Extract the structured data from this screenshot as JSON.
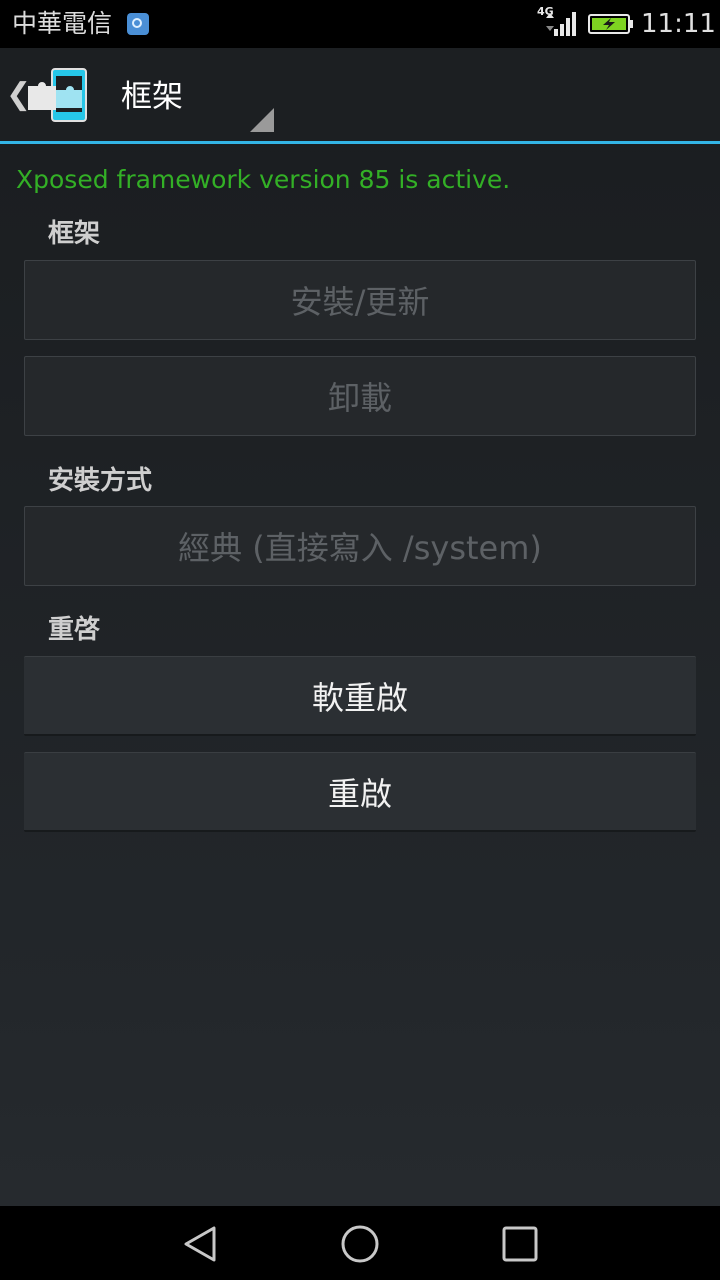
{
  "status_bar": {
    "carrier": "中華電信",
    "network": "4G",
    "time": "11:11",
    "icons": [
      "notification-app-icon",
      "signal-icon",
      "battery-charging-icon"
    ]
  },
  "action_bar": {
    "title": "框架",
    "icons": [
      "up-caret-icon",
      "xposed-puzzle-icon",
      "spinner-triangle-icon"
    ],
    "accent_color": "#33b5e5"
  },
  "content": {
    "status_message": "Xposed framework version 85 is active.",
    "status_color": "#33b026",
    "framework_section": {
      "header": "框架",
      "install_label": "安裝/更新",
      "uninstall_label": "卸載"
    },
    "install_method_section": {
      "header": "安裝方式",
      "method_label": "經典 (直接寫入 /system)"
    },
    "reboot_section": {
      "header": "重啓",
      "soft_reboot_label": "軟重啟",
      "reboot_label": "重啟"
    }
  },
  "nav_bar": {
    "icons": [
      "back-icon",
      "home-icon",
      "recents-icon"
    ]
  }
}
